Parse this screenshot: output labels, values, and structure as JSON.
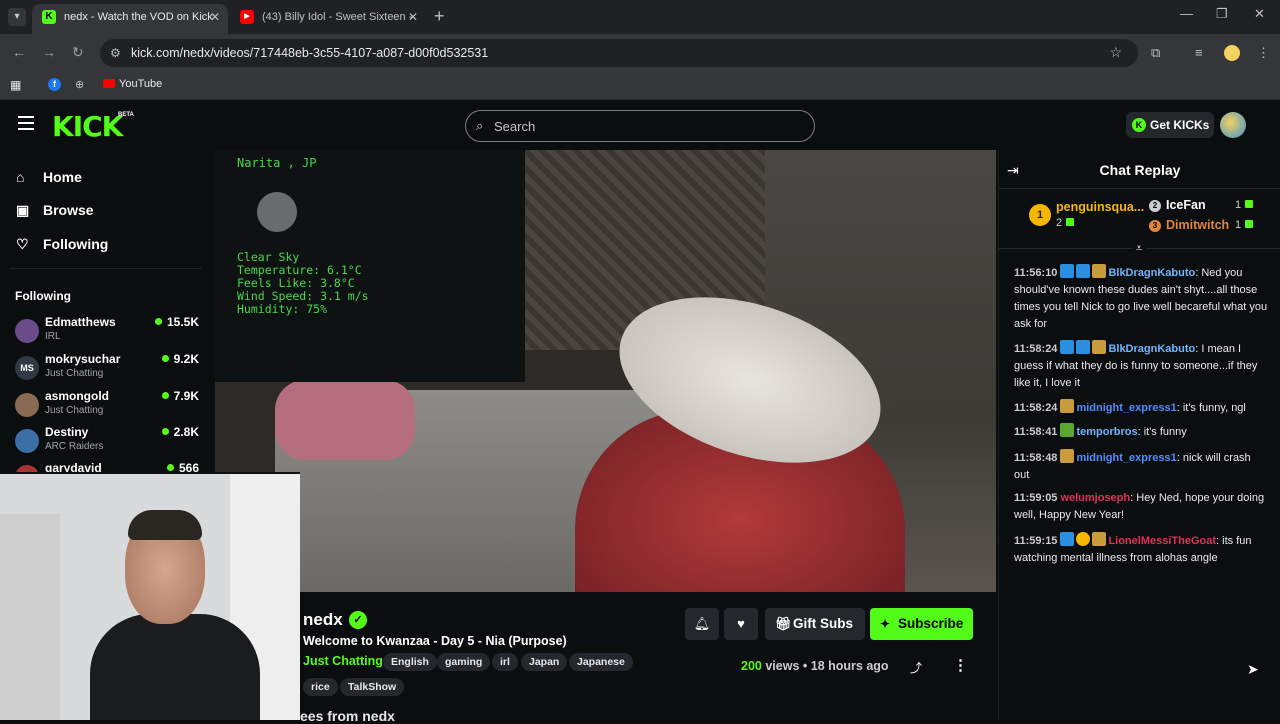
{
  "browser": {
    "tabs": [
      {
        "title": "nedx - Watch the VOD on Kick",
        "active": true
      },
      {
        "title": "(43) Billy Idol - Sweet Sixteen - ",
        "active": false
      }
    ],
    "url": "kick.com/nedx/videos/717448eb-3c55-4107-a087-d00f0d532531",
    "bookmarks": [
      {
        "label": "YouTube"
      }
    ]
  },
  "header": {
    "logo": "KICK",
    "logo_badge": "BETA",
    "search_placeholder": "Search",
    "get_kicks_label": "Get KICKs"
  },
  "sidebar": {
    "nav": [
      {
        "label": "Home",
        "icon": "home-icon"
      },
      {
        "label": "Browse",
        "icon": "browse-icon"
      },
      {
        "label": "Following",
        "icon": "heart-icon"
      }
    ],
    "following_title": "Following",
    "channels": [
      {
        "name": "Edmatthews",
        "category": "IRL",
        "viewers": "15.5K",
        "avatar_color": "#6b4c8a"
      },
      {
        "name": "mokrysuchar",
        "category": "Just Chatting",
        "viewers": "9.2K",
        "avatar_color": "#2f3a44",
        "avatar_text": "MS"
      },
      {
        "name": "asmongold",
        "category": "Just Chatting",
        "viewers": "7.9K",
        "avatar_color": "#8a6a52"
      },
      {
        "name": "Destiny",
        "category": "ARC Raiders",
        "viewers": "2.8K",
        "avatar_color": "#3a6ea5"
      },
      {
        "name": "garydavid",
        "category": "",
        "viewers": "566",
        "avatar_color": "#a33"
      }
    ]
  },
  "video": {
    "overlay": {
      "location": "Narita , JP",
      "lines": [
        "Clear Sky",
        "Temperature: 6.1°C",
        "Feels Like: 3.8°C",
        "Wind Speed: 3.1 m/s",
        "Humidity: 75%"
      ]
    }
  },
  "stream": {
    "streamer": "nedx",
    "title": "Welcome to Kwanzaa - Day 5 - Nia (Purpose)",
    "category": "Just Chatting",
    "tags": [
      "English",
      "gaming",
      "irl",
      "Japan",
      "Japanese",
      "rice",
      "TalkShow"
    ],
    "gift_subs_label": "Gift Subs",
    "subscribe_label": "Subscribe",
    "views_count": "200",
    "views_label": "views",
    "age": "18 hours ago",
    "more_section_cutoff": "ees from nedx"
  },
  "chat": {
    "title": "Chat Replay",
    "leaderboard": [
      {
        "rank": "1",
        "name": "penguinsqua...",
        "count": "2",
        "color": "#f5b700"
      },
      {
        "rank": "2",
        "name": "IceFan",
        "count": "1",
        "color": "#c9cdd0"
      },
      {
        "rank": "3",
        "name": "Dimitwitch",
        "count": "1",
        "color": "#e3853a"
      }
    ],
    "messages": [
      {
        "time": "11:56:10",
        "user": "BlkDragnKabuto",
        "user_color": "#6fb6ff",
        "badges": [
          "#2a8fe0",
          "#2a8fe0",
          "#c89b3c"
        ],
        "text": "Ned you should've known these dudes ain't shyt....all those times you tell Nick to go live well becareful what you ask for"
      },
      {
        "time": "11:58:24",
        "user": "BlkDragnKabuto",
        "user_color": "#6fb6ff",
        "badges": [
          "#2a8fe0",
          "#2a8fe0",
          "#c89b3c"
        ],
        "text": "I mean I guess if what they do is funny to someone...if they like it, I love it"
      },
      {
        "time": "11:58:24",
        "user": "midnight_express1",
        "user_color": "#4f8dff",
        "badges": [
          "#c89b3c"
        ],
        "text": "it's funny, ngl"
      },
      {
        "time": "11:58:41",
        "user": "temporbros",
        "user_color": "#6fb6ff",
        "badges": [
          "#5aa832"
        ],
        "text": "it's funny"
      },
      {
        "time": "11:58:48",
        "user": "midnight_express1",
        "user_color": "#4f8dff",
        "badges": [
          "#c89b3c"
        ],
        "text": "nick will crash out"
      },
      {
        "time": "11:59:05",
        "user": "welumjoseph",
        "user_color": "#e0315a",
        "badges": [],
        "text": "Hey Ned, hope your doing well, Happy New Year!"
      },
      {
        "time": "11:59:15",
        "user": "LionelMessiTheGoat",
        "user_color": "#e0315a",
        "badges": [
          "#2a8fe0",
          "#f5b700",
          "#c89b3c"
        ],
        "text": "its fun watching mental illness from alohas angle"
      }
    ]
  }
}
